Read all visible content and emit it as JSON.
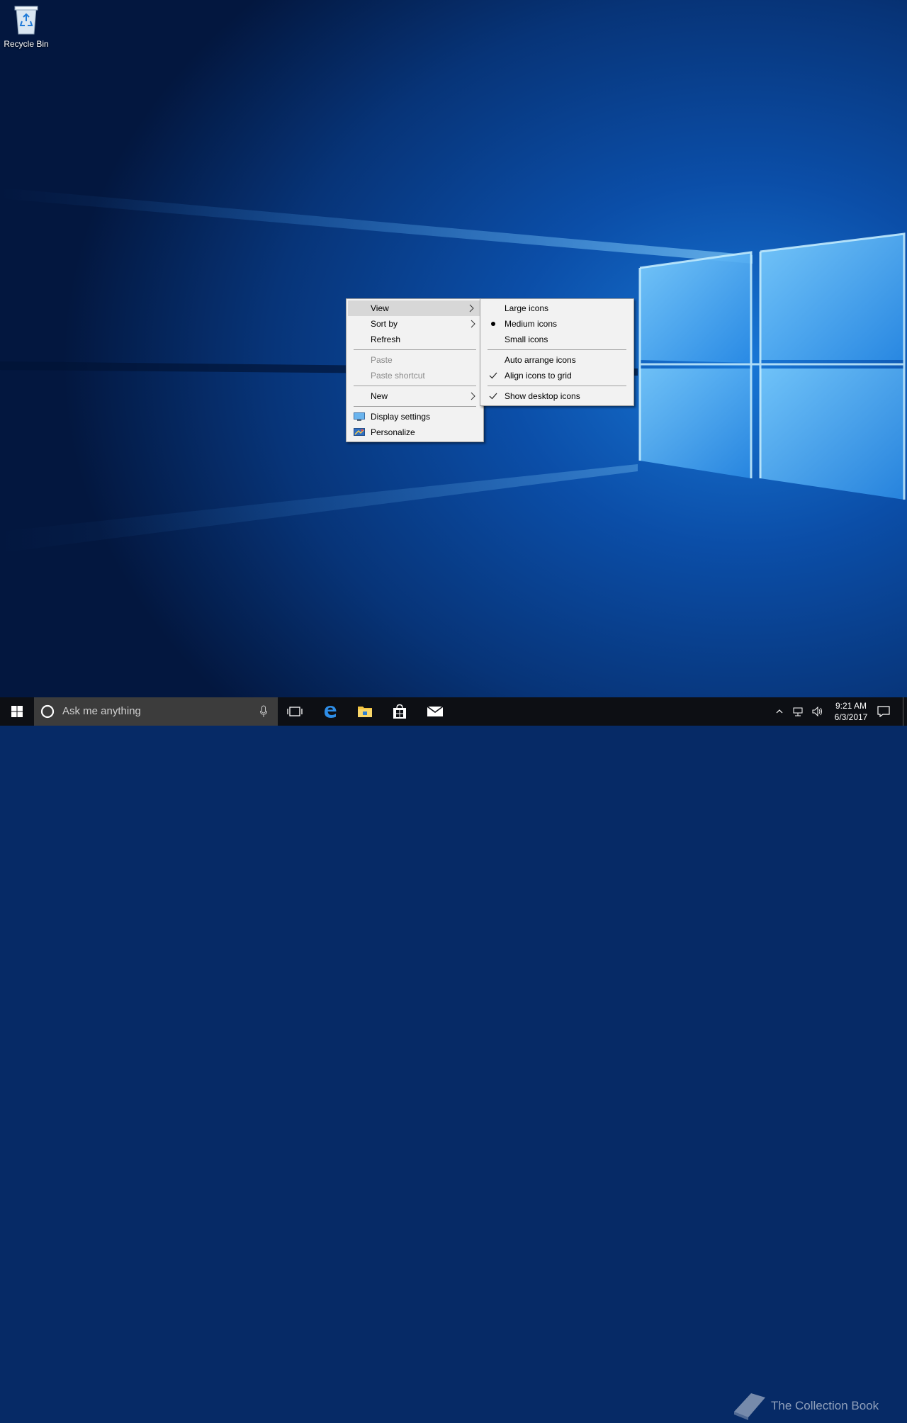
{
  "desktop": {
    "icons": [
      {
        "label": "Recycle Bin",
        "icon": "recycle-bin-icon"
      }
    ]
  },
  "context_menu": {
    "items": [
      {
        "label": "View",
        "has_submenu": true,
        "highlighted": true
      },
      {
        "label": "Sort by",
        "has_submenu": true
      },
      {
        "label": "Refresh"
      },
      {
        "label": "Paste",
        "disabled": true
      },
      {
        "label": "Paste shortcut",
        "disabled": true
      },
      {
        "label": "New",
        "has_submenu": true
      },
      {
        "label": "Display settings",
        "icon": "display-settings-icon"
      },
      {
        "label": "Personalize",
        "icon": "personalize-icon"
      }
    ]
  },
  "view_submenu": {
    "items": [
      {
        "label": "Large icons"
      },
      {
        "label": "Medium icons",
        "selected": true
      },
      {
        "label": "Small icons"
      },
      {
        "label": "Auto arrange icons"
      },
      {
        "label": "Align icons to grid",
        "checked": true
      },
      {
        "label": "Show desktop icons",
        "checked": true
      }
    ]
  },
  "taskbar": {
    "search_placeholder": "Ask me anything",
    "clock_time": "9:21 AM",
    "clock_date": "6/3/2017",
    "pinned": [
      "task-view-icon",
      "edge-icon",
      "file-explorer-icon",
      "store-icon",
      "mail-icon"
    ]
  },
  "watermark": "The Collection Book",
  "colors": {
    "wallpaper_dark": "#03173f",
    "wallpaper_mid": "#0b4ea8",
    "light_glow": "#4cb8ff",
    "taskbar": "#0d0f14",
    "menu_bg": "#f2f2f2",
    "menu_highlight": "#d7d7d7"
  }
}
